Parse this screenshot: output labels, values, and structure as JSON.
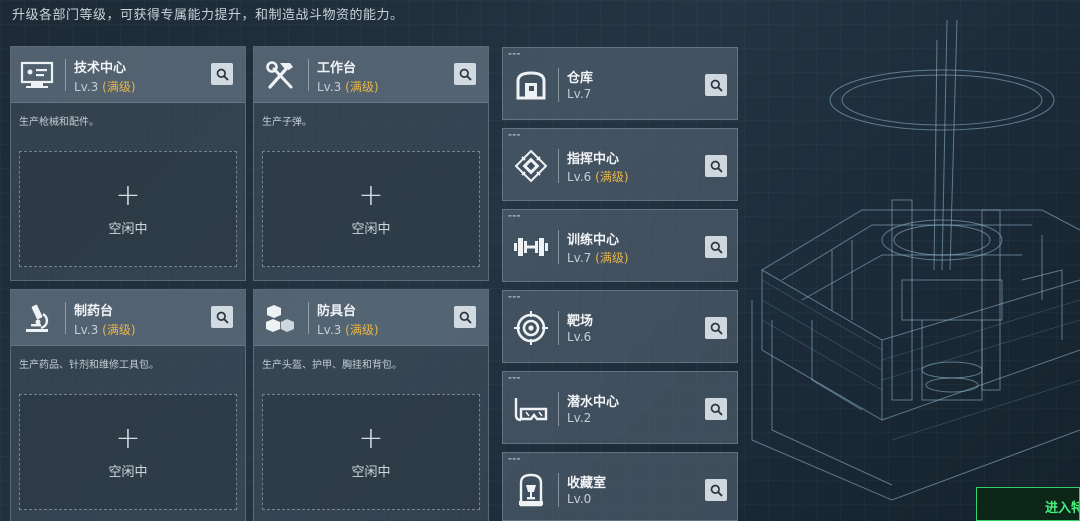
{
  "hint": "升级各部门等级，可获得专属能力提升，和制造战斗物资的能力。",
  "maxed_label": "(满级)",
  "colors": {
    "accent_gold": "#e7b54a",
    "enter_green": "#47f07f"
  },
  "workshops": [
    {
      "name": "技术中心",
      "level": "Lv.3",
      "desc": "生产枪械和配件。",
      "slot": {
        "plus": "+",
        "status": "空闲中"
      },
      "icon": "computer-icon"
    },
    {
      "name": "工作台",
      "level": "Lv.3",
      "desc": "生产子弹。",
      "slot": {
        "plus": "+",
        "status": "空闲中"
      },
      "icon": "hammer-wrench-icon"
    },
    {
      "name": "制药台",
      "level": "Lv.3",
      "desc": "生产药品、针剂和维修工具包。",
      "slot": {
        "plus": "+",
        "status": "空闲中"
      },
      "icon": "microscope-icon"
    },
    {
      "name": "防具台",
      "level": "Lv.3",
      "desc": "生产头盔、护甲、胸挂和背包。",
      "slot": {
        "plus": "+",
        "status": "空闲中"
      },
      "icon": "cubes-icon"
    }
  ],
  "departments": [
    {
      "name": "仓库",
      "level": "Lv.7",
      "maxed": false,
      "icon": "warehouse-icon"
    },
    {
      "name": "指挥中心",
      "level": "Lv.6",
      "maxed": true,
      "icon": "chip-icon"
    },
    {
      "name": "训练中心",
      "level": "Lv.7",
      "maxed": true,
      "icon": "dumbbell-icon"
    },
    {
      "name": "靶场",
      "level": "Lv.6",
      "maxed": false,
      "icon": "target-icon"
    },
    {
      "name": "潜水中心",
      "level": "Lv.2",
      "maxed": false,
      "icon": "diving-mask-icon"
    },
    {
      "name": "收藏室",
      "level": "Lv.0",
      "maxed": false,
      "icon": "trophy-display-icon"
    }
  ],
  "enter_button": "进入特"
}
